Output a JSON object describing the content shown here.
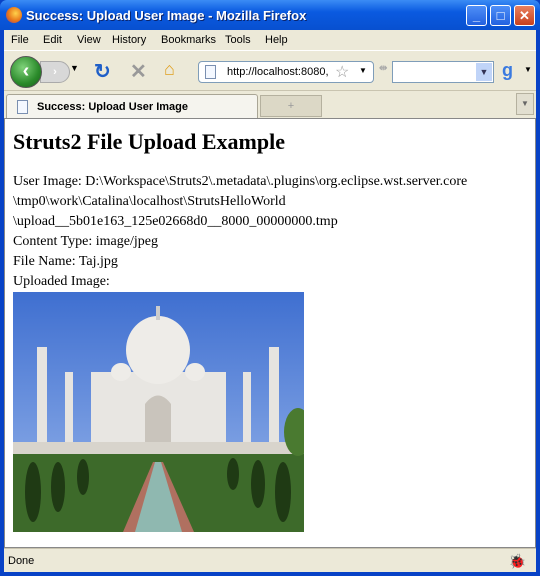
{
  "window": {
    "title": "Success: Upload User Image - Mozilla Firefox",
    "buttons": {
      "minimize": "_",
      "maximize": "□",
      "close": "✕"
    }
  },
  "menu": [
    "File",
    "Edit",
    "View",
    "History",
    "Bookmarks",
    "Tools",
    "Help"
  ],
  "nav": {
    "url": "http://localhost:8080,",
    "search_value": ""
  },
  "tabs": [
    {
      "label": "Success: Upload User Image"
    }
  ],
  "page": {
    "heading": "Struts2 File Upload Example",
    "lines": [
      "User Image: D:\\Workspace\\Struts2\\.metadata\\.plugins\\org.eclipse.wst.server.core",
      "\\tmp0\\work\\Catalina\\localhost\\StrutsHelloWorld",
      "\\upload__5b01e163_125e02668d0__8000_00000000.tmp",
      "Content Type: image/jpeg",
      "File Name: Taj.jpg",
      "Uploaded Image:"
    ]
  },
  "status": {
    "text": "Done"
  },
  "colors": {
    "titlebar": "#0a5ae0",
    "chrome": "#ece9d8"
  }
}
